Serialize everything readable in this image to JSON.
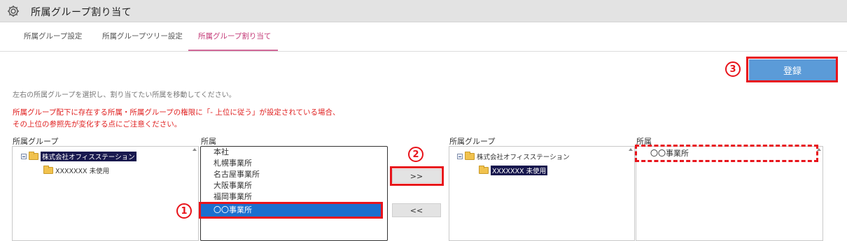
{
  "titlebar": {
    "title": "所属グループ割り当て"
  },
  "tabs": [
    {
      "label": "所属グループ設定"
    },
    {
      "label": "所属グループツリー設定"
    },
    {
      "label": "所属グループ割り当て"
    }
  ],
  "toolbar": {
    "register_label": "登録"
  },
  "instruction": "左右の所属グループを選択し、割り当てたい所属を移動してください。",
  "warning": {
    "line1": "所属グループ配下に存在する所属・所属グループの権限に「- 上位に従う」が設定されている場合、",
    "line2": "その上位の参照先が変化する点にご注意ください。"
  },
  "left": {
    "group_label": "所属グループ",
    "tree": {
      "root": "株式会社オフィスステーション",
      "child": "XXXXXXX 未使用"
    },
    "dept_label": "所属",
    "depts": [
      "本社",
      "札幌事業所",
      "名古屋事業所",
      "大阪事業所",
      "福岡事業所",
      "〇〇事業所"
    ],
    "selected_dept_index": 5
  },
  "move": {
    "add_label": ">>",
    "remove_label": "<<"
  },
  "right": {
    "group_label": "所属グループ",
    "tree": {
      "root": "株式会社オフィスステーション",
      "child": "XXXXXXX 未使用"
    },
    "dept_label": "所属",
    "depts": [
      "〇〇事業所"
    ]
  },
  "annotations": {
    "step1": "1",
    "step2": "2",
    "step3": "3",
    "color": "#e8141b"
  }
}
